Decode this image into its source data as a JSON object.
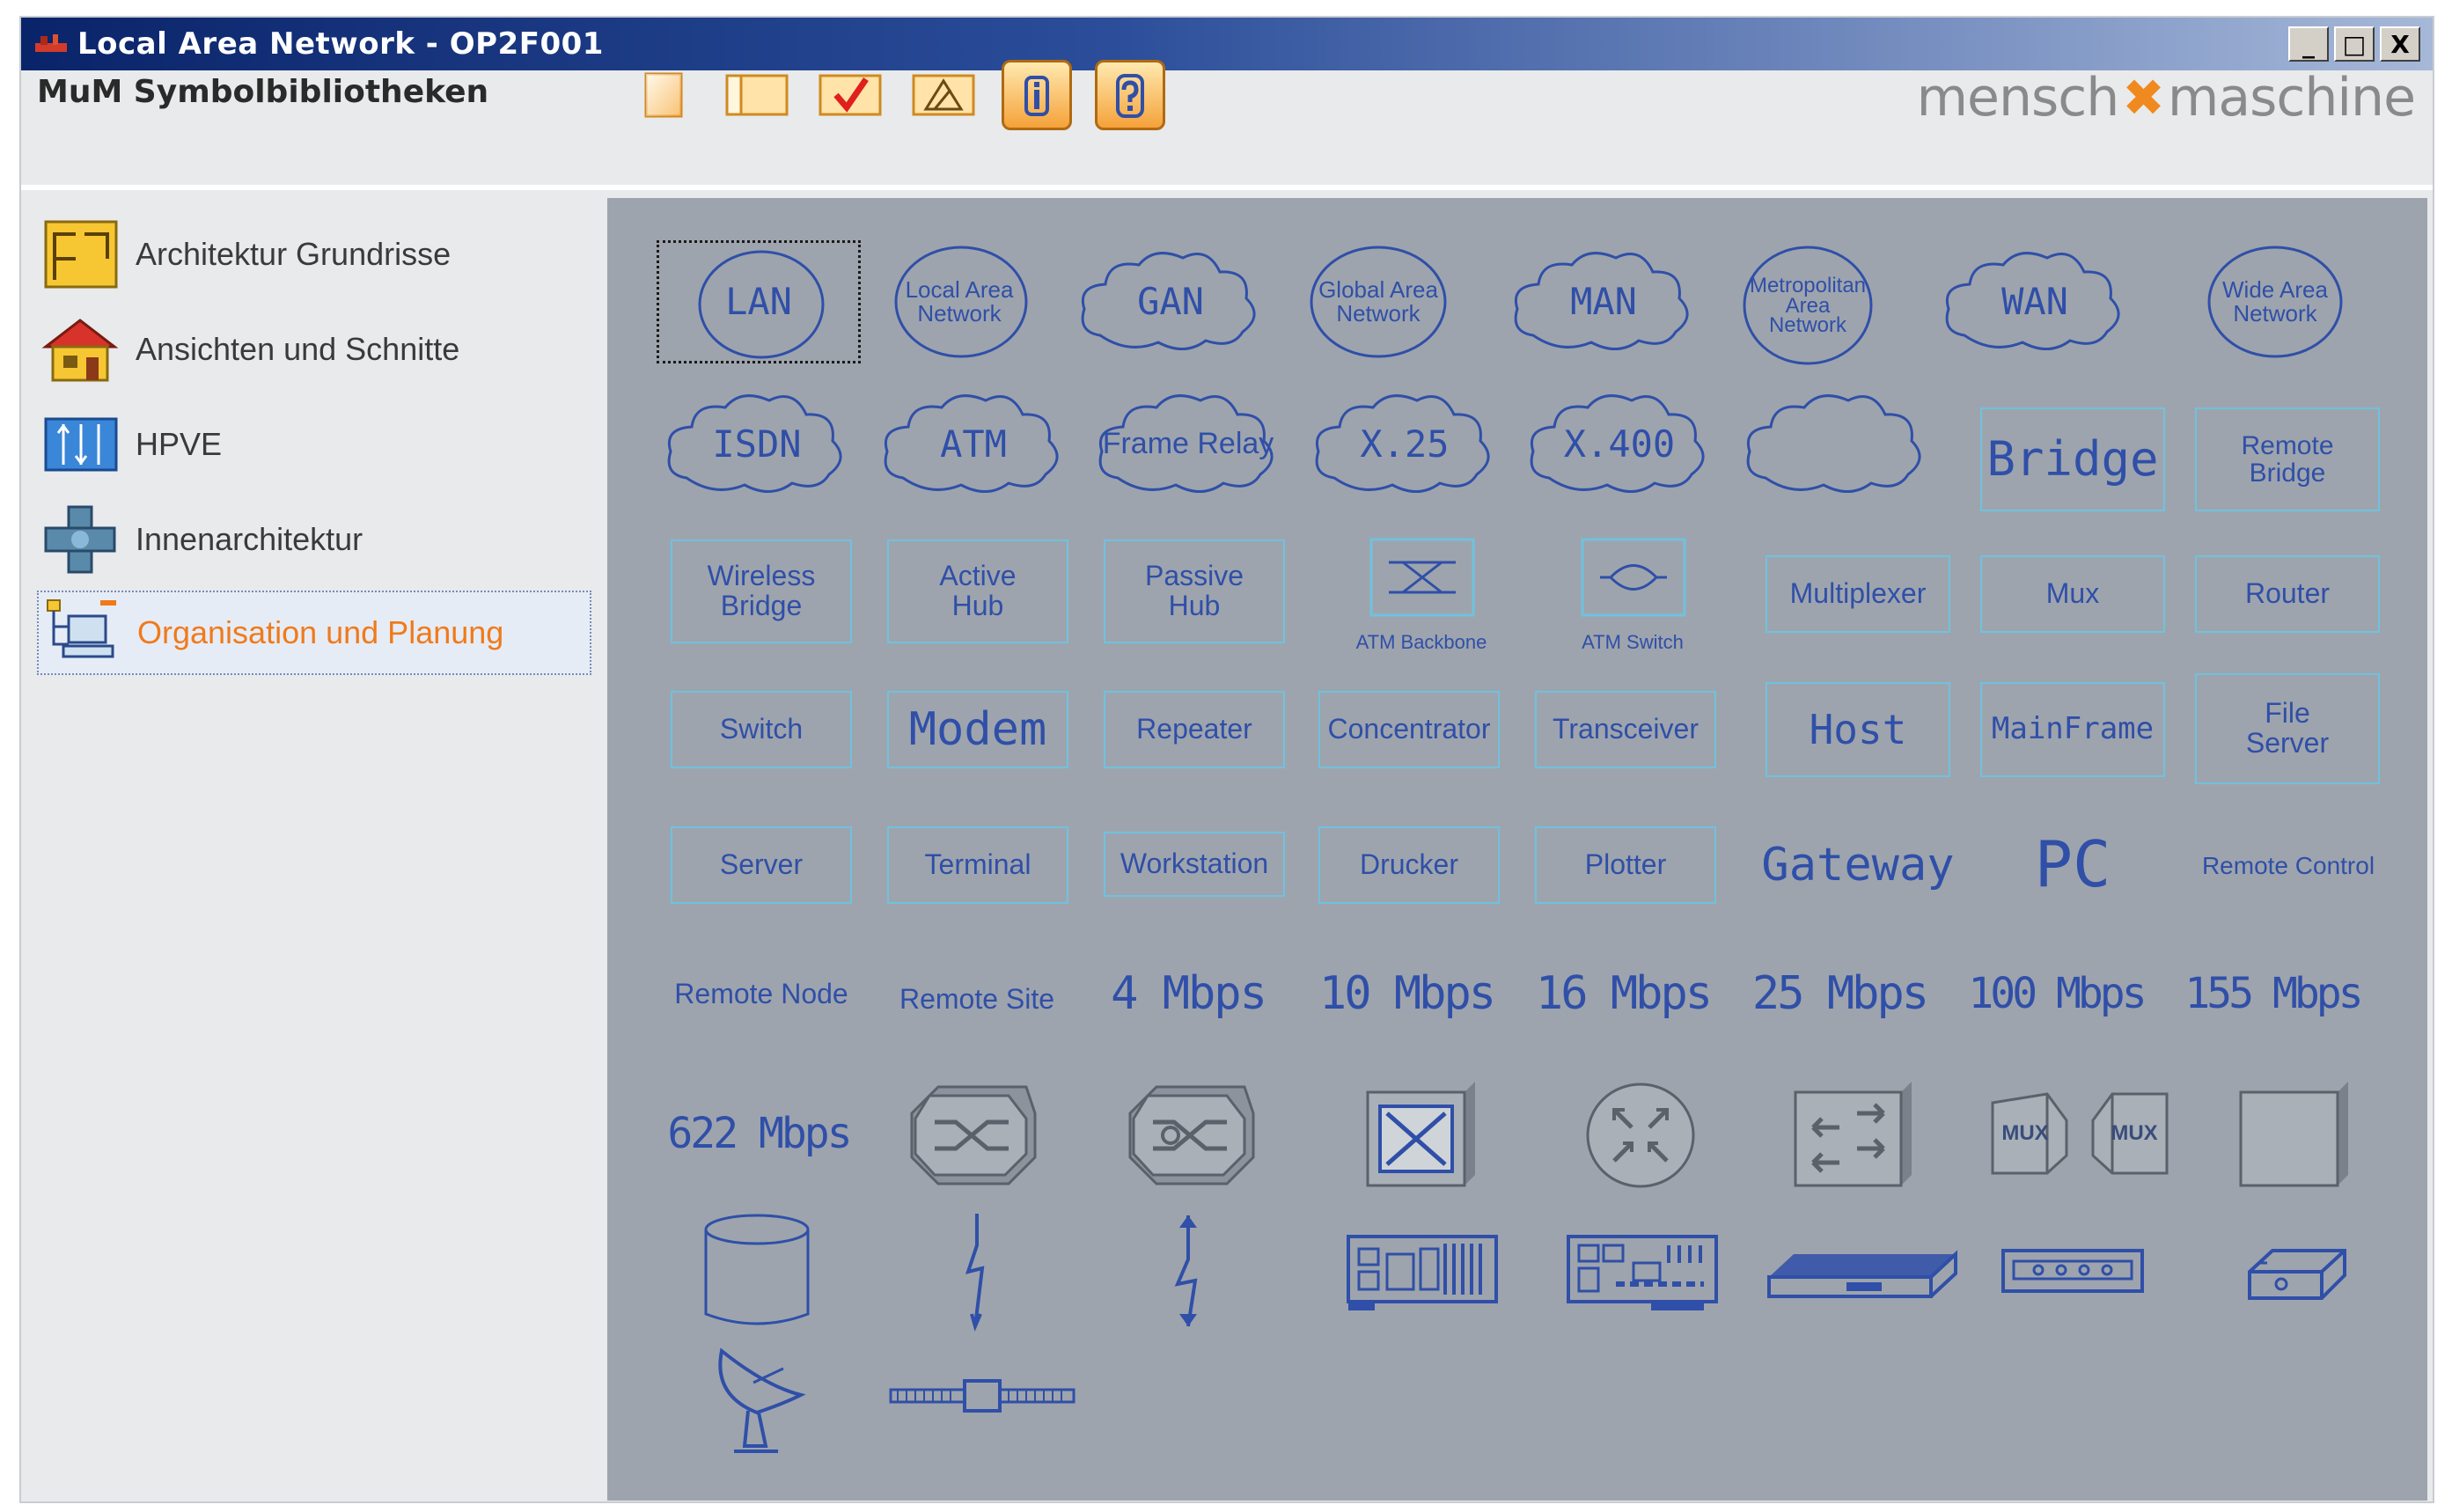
{
  "window": {
    "title": "Local Area Network - OP2F001",
    "buttons": [
      "_",
      "□",
      "X"
    ]
  },
  "header": {
    "library_title": "MuM Symbolbibliotheken",
    "brand_left": "mensch",
    "brand_right": "maschine",
    "toolbar": [
      "new-icon",
      "panel-icon",
      "check-icon",
      "edit-icon",
      "info-icon",
      "help-icon"
    ]
  },
  "sidebar": {
    "items": [
      {
        "label": "Architektur Grundrisse",
        "icon": "floorplan-icon"
      },
      {
        "label": "Ansichten und Schnitte",
        "icon": "house-icon"
      },
      {
        "label": "HPVE",
        "icon": "hpve-icon"
      },
      {
        "label": "Innenarchitektur",
        "icon": "interior-icon"
      },
      {
        "label": "Organisation und Planung",
        "icon": "organisation-icon",
        "selected": true
      }
    ]
  },
  "symbols": {
    "lan": "LAN",
    "local_area_network": [
      "Local Area",
      "Network"
    ],
    "gan": "GAN",
    "global_area_network": [
      "Global Area",
      "Network"
    ],
    "man": "MAN",
    "metropolitan": [
      "Metropolitan",
      "Area",
      "Network"
    ],
    "wan": "WAN",
    "wide_area_network": [
      "Wide Area",
      "Network"
    ],
    "isdn": "ISDN",
    "atm": "ATM",
    "frame_relay": "Frame Relay",
    "x25": "X.25",
    "x400": "X.400",
    "bridge": "Bridge",
    "remote_bridge": [
      "Remote",
      "Bridge"
    ],
    "wireless_bridge": [
      "Wireless",
      "Bridge"
    ],
    "active_hub": [
      "Active",
      "Hub"
    ],
    "passive_hub": [
      "Passive",
      "Hub"
    ],
    "atm_backbone": "ATM Backbone",
    "atm_switch": "ATM Switch",
    "multiplexer": "Multiplexer",
    "mux": "Mux",
    "router": "Router",
    "switch": "Switch",
    "modem": "Modem",
    "repeater": "Repeater",
    "concentrator": "Concentrator",
    "transceiver": "Transceiver",
    "host": "Host",
    "mainframe": "MainFrame",
    "file_server": [
      "File",
      "Server"
    ],
    "server": "Server",
    "terminal": "Terminal",
    "workstation": "Workstation",
    "drucker": "Drucker",
    "plotter": "Plotter",
    "gateway": "Gateway",
    "pc": "PC",
    "remote_control": "Remote Control",
    "remote_node": "Remote Node",
    "remote_site": "Remote Site",
    "mbps_4": "4 Mbps",
    "mbps_10": "10 Mbps",
    "mbps_16": "16 Mbps",
    "mbps_25": "25 Mbps",
    "mbps_100": "100 Mbps",
    "mbps_155": "155 Mbps",
    "mbps_622": "622 Mbps",
    "mux_a": "MUX",
    "mux_b": "MUX"
  },
  "colors": {
    "canvas": "#9ea4ad",
    "symbol_text": "#2f4fa8",
    "symbol_border": "#6fc2de",
    "selected_label": "#f07a1a"
  }
}
